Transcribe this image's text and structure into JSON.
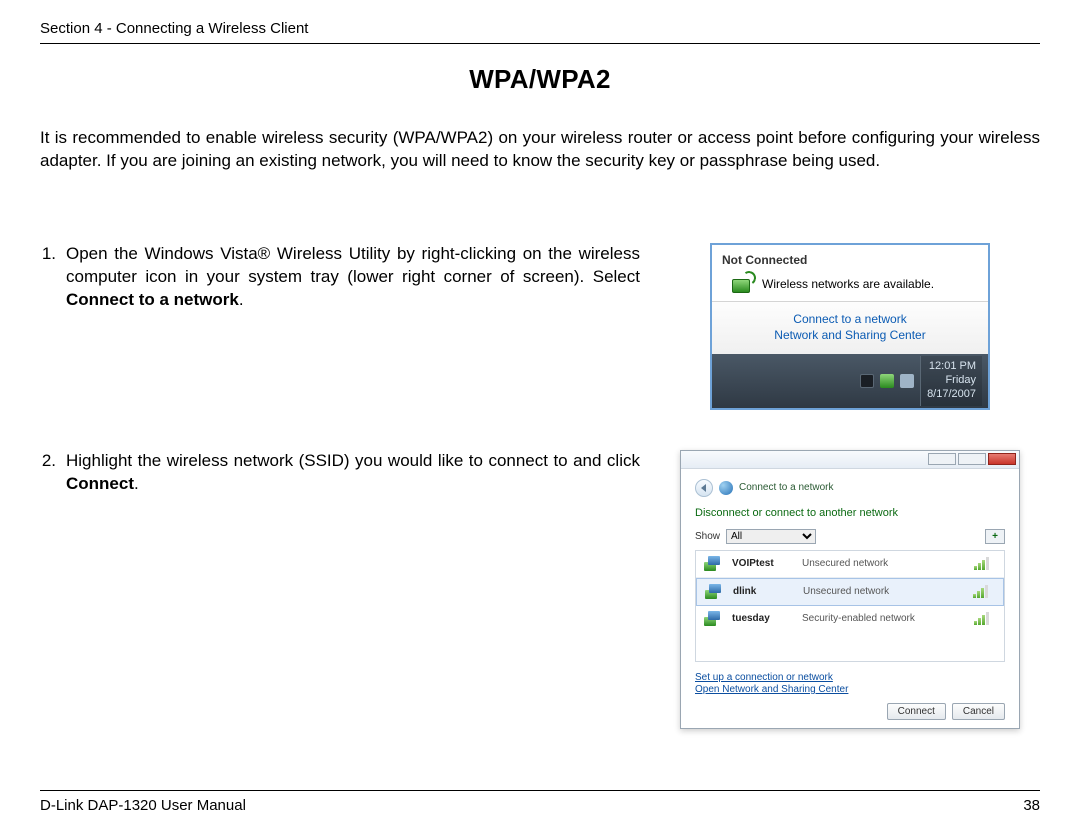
{
  "header": {
    "section": "Section 4 - Connecting a Wireless Client"
  },
  "title": "WPA/WPA2",
  "intro": "It is recommended to enable wireless security (WPA/WPA2) on your wireless router or access point before configuring your wireless adapter. If you are joining an existing network, you will need to know the security key or passphrase being used.",
  "steps": [
    {
      "num": "1.",
      "pre": "Open the Windows Vista® Wireless Utility by right-clicking on the wireless computer icon in your system tray (lower right corner of screen). Select ",
      "bold": "Connect to a network",
      "post": "."
    },
    {
      "num": "2.",
      "pre": "Highlight the wireless network (SSID) you would like to connect to and click ",
      "bold": "Connect",
      "post": "."
    }
  ],
  "fig1": {
    "status": "Not Connected",
    "msg": "Wireless networks are available.",
    "link1": "Connect to a network",
    "link2": "Network and Sharing Center",
    "time": "12:01 PM",
    "day": "Friday",
    "date": "8/17/2007"
  },
  "fig2": {
    "title": "Connect to a network",
    "subtitle": "Disconnect or connect to another network",
    "show_label": "Show",
    "show_value": "All",
    "plus": "+",
    "rows": [
      {
        "name": "VOIPtest",
        "sec": "Unsecured network"
      },
      {
        "name": "dlink",
        "sec": "Unsecured network"
      },
      {
        "name": "tuesday",
        "sec": "Security-enabled network"
      }
    ],
    "link_setup": "Set up a connection or network",
    "link_open": "Open Network and Sharing Center",
    "btn_connect": "Connect",
    "btn_cancel": "Cancel"
  },
  "footer": {
    "left": "D-Link DAP-1320 User Manual",
    "right": "38"
  }
}
